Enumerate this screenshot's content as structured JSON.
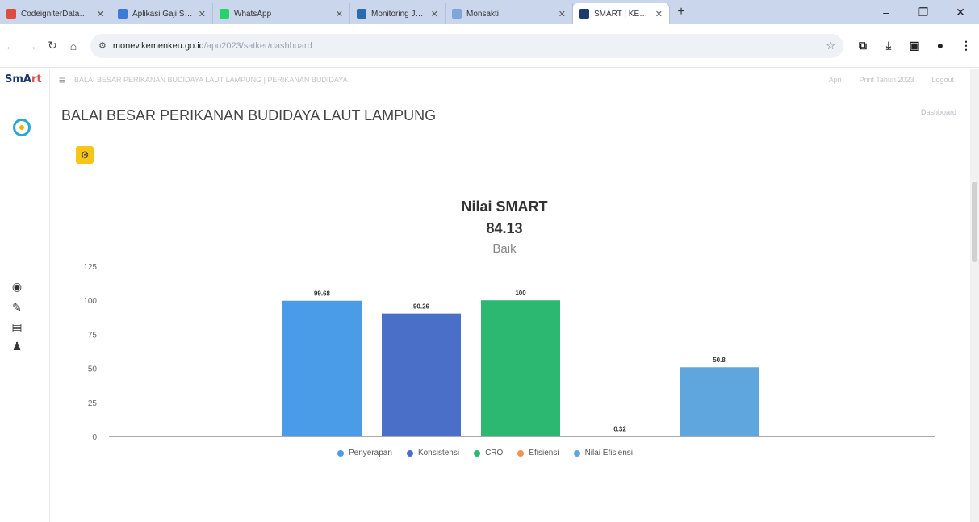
{
  "browser": {
    "tabs": [
      {
        "label": "CodeigniterDatabas",
        "color": "#e04b3f",
        "active": false
      },
      {
        "label": "Aplikasi Gaji Satker",
        "color": "#3a7bd5",
        "active": false
      },
      {
        "label": "WhatsApp",
        "color": "#25d366",
        "active": false
      },
      {
        "label": "Monitoring Jurnal",
        "color": "#2b6cb0",
        "active": false
      },
      {
        "label": "Monsakti",
        "color": "#7fa6d9",
        "active": false
      },
      {
        "label": "SMART | KEMENKEU",
        "color": "#1c3a6e",
        "active": true
      }
    ],
    "url_host": "monev.kemenkeu.go.id",
    "url_path": "/apo2023/satker/dashboard"
  },
  "app": {
    "logo_main": "SmA",
    "logo_accent": "rt",
    "topbar_text": "BALAI BESAR PERIKANAN BUDIDAYA LAUT LAMPUNG | PERIKANAN BUDIDAYA",
    "topbar_right": [
      "Apri",
      "Print Tahun 2023",
      "Logout"
    ],
    "page_title": "BALAI BESAR PERIKANAN BUDIDAYA LAUT LAMPUNG",
    "breadcrumb": "Dashboard"
  },
  "chart_data": {
    "type": "bar",
    "title": "Nilai SMART",
    "subtitle_value": "84.13",
    "subtitle_label": "Baik",
    "categories": [
      "Penyerapan",
      "Konsistensi",
      "CRO",
      "Efisiensi",
      "Nilai Efisiensi"
    ],
    "values": [
      99.68,
      90.26,
      100,
      0.32,
      50.8
    ],
    "value_labels": [
      "99.68",
      "90.26",
      "100",
      "0.32",
      "50.8"
    ],
    "colors": [
      "#4a9be8",
      "#4a6fc9",
      "#2db872",
      "#f39255",
      "#5fa6de"
    ],
    "yticks": [
      "0",
      "25",
      "50",
      "75",
      "100",
      "125"
    ],
    "ylim": [
      0,
      125
    ],
    "legend": "bottom",
    "grid": false
  }
}
